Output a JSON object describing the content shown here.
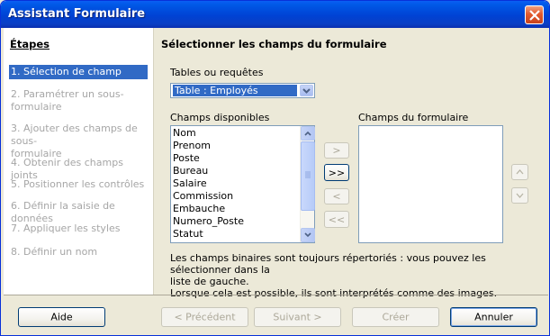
{
  "window": {
    "title": "Assistant Formulaire"
  },
  "sidebar": {
    "title": "Étapes",
    "steps": [
      {
        "label": "1. Sélection de champ",
        "active": true
      },
      {
        "label": "2. Paramétrer un sous-",
        "label2": "formulaire"
      },
      {
        "label": "3. Ajouter des champs de sous-",
        "label2": "formulaire"
      },
      {
        "label": "4. Obtenir des champs joints"
      },
      {
        "label": "5. Positionner les contrôles"
      },
      {
        "label": "6. Définir la saisie de données"
      },
      {
        "label": "7. Appliquer les styles"
      },
      {
        "label": "8. Définir un nom"
      }
    ]
  },
  "main": {
    "title": "Sélectionner les champs du formulaire",
    "tables_label": "Tables ou requêtes",
    "tables_value": "Table : Employés",
    "available_label": "Champs disponibles",
    "available_fields": [
      "Nom",
      "Prenom",
      "Poste",
      "Bureau",
      "Salaire",
      "Commission",
      "Embauche",
      "Numero_Poste",
      "Statut"
    ],
    "form_fields_label": "Champs du formulaire",
    "move_buttons": {
      "add_one": ">",
      "add_all": ">>",
      "remove_one": "<",
      "remove_all": "<<"
    },
    "order_buttons": {
      "up": "^",
      "down": "v"
    },
    "info_line1": "Les champs binaires sont toujours répertoriés : vous pouvez les sélectionner dans la",
    "info_line2": "liste de gauche.",
    "info_line3": "Lorsque cela est possible, ils sont interprétés comme des images."
  },
  "footer": {
    "help": "Aide",
    "previous": "< Précédent",
    "next": "Suivant >",
    "create": "Créer",
    "cancel": "Annuler"
  }
}
